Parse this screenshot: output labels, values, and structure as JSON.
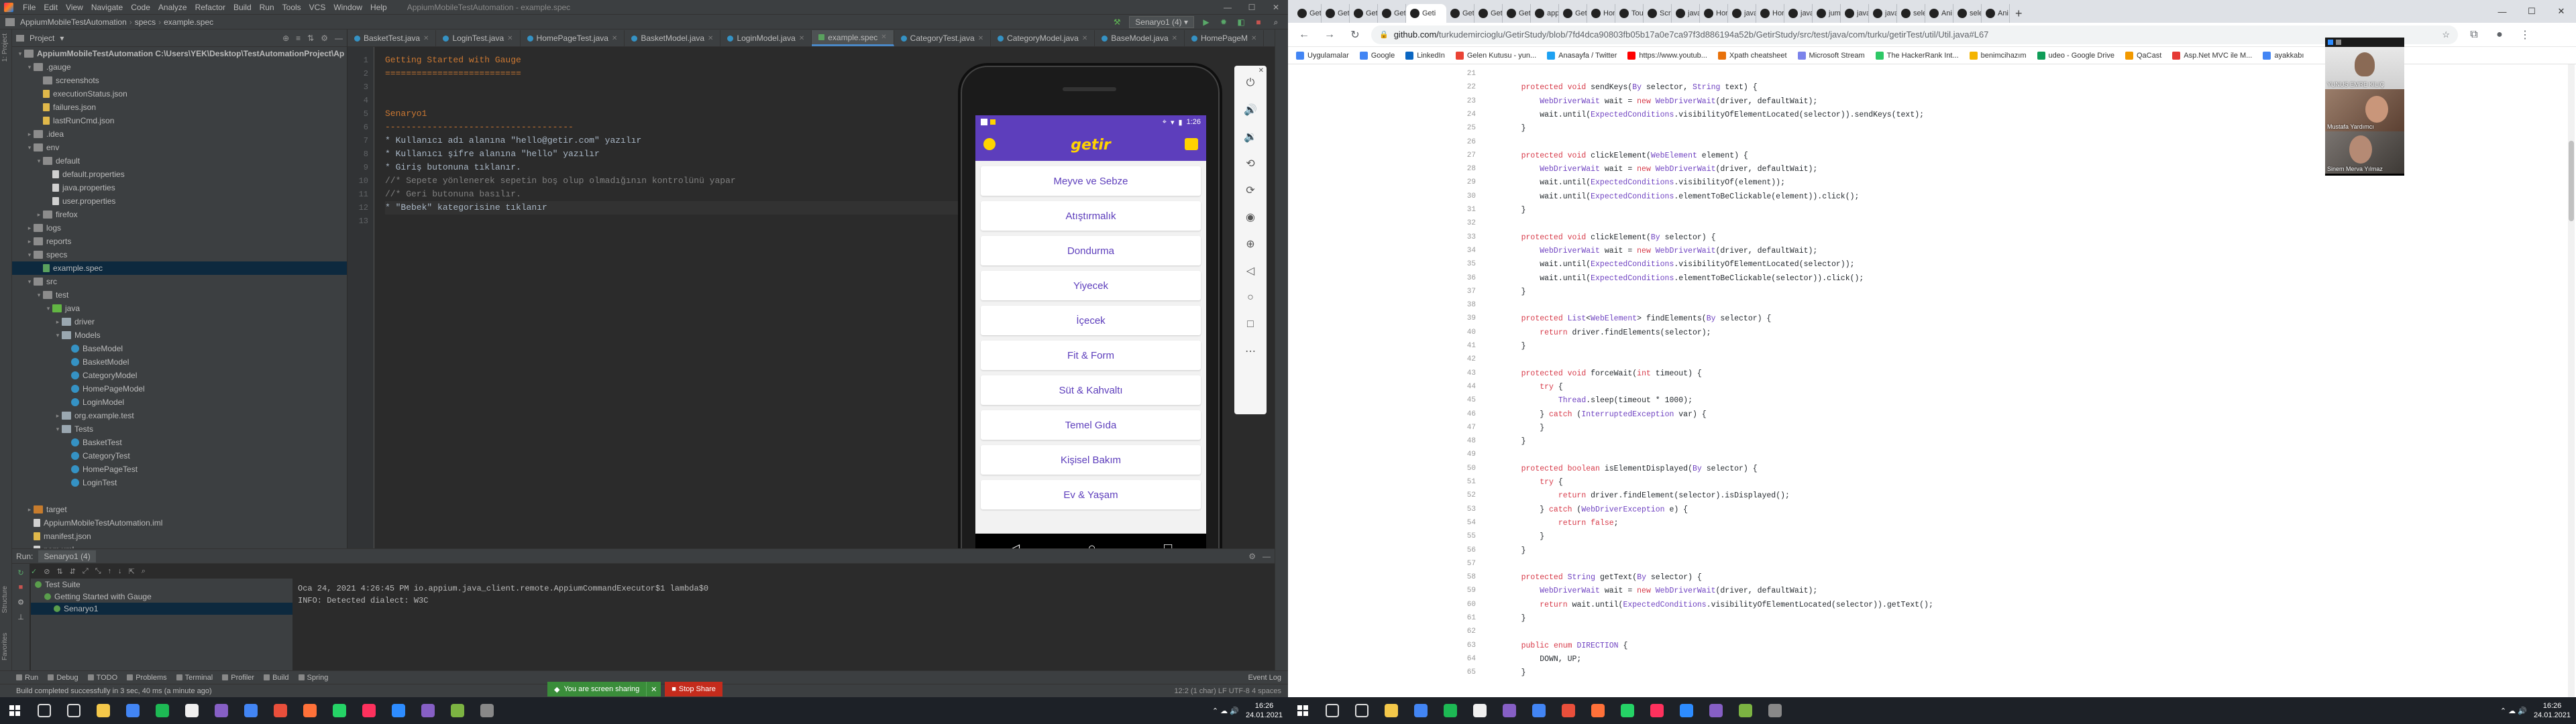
{
  "ide": {
    "title": "AppiumMobileTestAutomation - example.spec",
    "menu": [
      "File",
      "Edit",
      "View",
      "Navigate",
      "Code",
      "Analyze",
      "Refactor",
      "Build",
      "Run",
      "Tools",
      "VCS",
      "Window",
      "Help"
    ],
    "breadcrumb": [
      "AppiumMobileTestAutomation",
      "specs",
      "example.spec"
    ],
    "run_config": "Senaryo1 (4)",
    "project_label": "Project",
    "tree": [
      {
        "label": "AppiumMobileTestAutomation  C:\\Users\\YEK\\Desktop\\TestAutomationProject\\Ap",
        "depth": 0,
        "icon": "folder",
        "arrow": "▾",
        "bold": true
      },
      {
        "label": ".gauge",
        "depth": 1,
        "icon": "folder",
        "arrow": "▾"
      },
      {
        "label": "screenshots",
        "depth": 2,
        "icon": "folder",
        "arrow": ""
      },
      {
        "label": "executionStatus.json",
        "depth": 2,
        "icon": "json",
        "arrow": ""
      },
      {
        "label": "failures.json",
        "depth": 2,
        "icon": "json",
        "arrow": ""
      },
      {
        "label": "lastRunCmd.json",
        "depth": 2,
        "icon": "json",
        "arrow": ""
      },
      {
        "label": ".idea",
        "depth": 1,
        "icon": "folder",
        "arrow": "▸"
      },
      {
        "label": "env",
        "depth": 1,
        "icon": "folder",
        "arrow": "▾"
      },
      {
        "label": "default",
        "depth": 2,
        "icon": "folder",
        "arrow": "▾"
      },
      {
        "label": "default.properties",
        "depth": 3,
        "icon": "file",
        "arrow": ""
      },
      {
        "label": "java.properties",
        "depth": 3,
        "icon": "file",
        "arrow": ""
      },
      {
        "label": "user.properties",
        "depth": 3,
        "icon": "file",
        "arrow": ""
      },
      {
        "label": "firefox",
        "depth": 2,
        "icon": "folder",
        "arrow": "▸"
      },
      {
        "label": "logs",
        "depth": 1,
        "icon": "folder",
        "arrow": "▸"
      },
      {
        "label": "reports",
        "depth": 1,
        "icon": "folder",
        "arrow": "▸"
      },
      {
        "label": "specs",
        "depth": 1,
        "icon": "folder",
        "arrow": "▾"
      },
      {
        "label": "example.spec",
        "depth": 2,
        "icon": "spec",
        "arrow": "",
        "selected": true
      },
      {
        "label": "src",
        "depth": 1,
        "icon": "folder",
        "arrow": "▾"
      },
      {
        "label": "test",
        "depth": 2,
        "icon": "folder",
        "arrow": "▾"
      },
      {
        "label": "java",
        "depth": 3,
        "icon": "test",
        "arrow": "▾"
      },
      {
        "label": "driver",
        "depth": 4,
        "icon": "pkg",
        "arrow": "▸"
      },
      {
        "label": "Models",
        "depth": 4,
        "icon": "pkg",
        "arrow": "▾"
      },
      {
        "label": "BaseModel",
        "depth": 5,
        "icon": "class",
        "arrow": ""
      },
      {
        "label": "BasketModel",
        "depth": 5,
        "icon": "class",
        "arrow": ""
      },
      {
        "label": "CategoryModel",
        "depth": 5,
        "icon": "class",
        "arrow": ""
      },
      {
        "label": "HomePageModel",
        "depth": 5,
        "icon": "class",
        "arrow": ""
      },
      {
        "label": "LoginModel",
        "depth": 5,
        "icon": "class",
        "arrow": ""
      },
      {
        "label": "org.example.test",
        "depth": 4,
        "icon": "pkg",
        "arrow": "▸"
      },
      {
        "label": "Tests",
        "depth": 4,
        "icon": "pkg",
        "arrow": "▾"
      },
      {
        "label": "BasketTest",
        "depth": 5,
        "icon": "class",
        "arrow": ""
      },
      {
        "label": "CategoryTest",
        "depth": 5,
        "icon": "class",
        "arrow": ""
      },
      {
        "label": "HomePageTest",
        "depth": 5,
        "icon": "class",
        "arrow": ""
      },
      {
        "label": "LoginTest",
        "depth": 5,
        "icon": "class",
        "arrow": ""
      },
      {
        "label": "",
        "depth": 0,
        "icon": "",
        "arrow": ""
      },
      {
        "label": "target",
        "depth": 1,
        "icon": "excl",
        "arrow": "▸"
      },
      {
        "label": "AppiumMobileTestAutomation.iml",
        "depth": 1,
        "icon": "file",
        "arrow": ""
      },
      {
        "label": "manifest.json",
        "depth": 1,
        "icon": "json",
        "arrow": ""
      },
      {
        "label": "pom.xml",
        "depth": 1,
        "icon": "file",
        "arrow": ""
      }
    ],
    "tabs": [
      {
        "label": "BasketTest.java",
        "type": "class"
      },
      {
        "label": "LoginTest.java",
        "type": "class"
      },
      {
        "label": "HomePageTest.java",
        "type": "class"
      },
      {
        "label": "BasketModel.java",
        "type": "class"
      },
      {
        "label": "LoginModel.java",
        "type": "class"
      },
      {
        "label": "example.spec",
        "type": "spec",
        "active": true
      },
      {
        "label": "CategoryTest.java",
        "type": "class"
      },
      {
        "label": "CategoryModel.java",
        "type": "class"
      },
      {
        "label": "BaseModel.java",
        "type": "class"
      },
      {
        "label": "HomePageM",
        "type": "class"
      }
    ],
    "line_numbers": [
      "1",
      "2",
      "3",
      "4",
      "5",
      "6",
      "7",
      "8",
      "9",
      "10",
      "11",
      "12",
      "13"
    ],
    "code_lines": [
      {
        "text": "Getting Started with Gauge",
        "cls": "c-heading"
      },
      {
        "text": "==========================",
        "cls": "c-heading"
      },
      {
        "text": "",
        "cls": ""
      },
      {
        "text": "",
        "cls": ""
      },
      {
        "text": "Senaryo1",
        "cls": "c-sub"
      },
      {
        "text": "------------------------------------",
        "cls": "c-sub"
      },
      {
        "text": "* Kullanıcı adı alanına \"hello@getir.com\" yazılır",
        "cls": "c-step"
      },
      {
        "text": "* Kullanıcı şifre alanına \"hello\" yazılır",
        "cls": "c-step"
      },
      {
        "text": "* Giriş butonuna tıklanır.",
        "cls": "c-step"
      },
      {
        "text": "//* Sepete yönlenerek sepetin boş olup olmadığının kontrolünü yapar",
        "cls": "c-comment"
      },
      {
        "text": "//* Geri butonuna basılır.",
        "cls": "c-comment"
      },
      {
        "text": "* \"Bebek\" kategorisine tıklanır",
        "cls": "c-step"
      },
      {
        "text": "",
        "cls": ""
      }
    ],
    "run": {
      "label": "Run:",
      "config": "Senaryo1 (4)",
      "tree": [
        {
          "label": "Test Suite",
          "depth": 0
        },
        {
          "label": "Getting Started with Gauge",
          "depth": 1
        },
        {
          "label": "Senaryo1",
          "depth": 2,
          "selected": true
        }
      ],
      "console": [
        "Oca 24, 2021 4:26:45 PM io.appium.java_client.remote.AppiumCommandExecutor$1 lambda$0",
        "INFO: Detected dialect: W3C"
      ]
    },
    "bottom_tools": [
      "Run",
      "Debug",
      "TODO",
      "Problems",
      "Terminal",
      "Profiler",
      "Build",
      "Spring"
    ],
    "event_log": "Event Log",
    "status": "Build completed successfully in 3 sec, 40 ms (a minute ago)",
    "status_right": "12:2 (1 char)   LF   UTF-8   4 spaces",
    "share_msg": "You are screen sharing",
    "stop_share": "Stop Share"
  },
  "phone": {
    "time": "1:26",
    "brand": "getir",
    "categories": [
      "Meyve ve Sebze",
      "Atıştırmalık",
      "Dondurma",
      "Yiyecek",
      "İçecek",
      "Fit & Form",
      "Süt & Kahvaltı",
      "Temel Gıda",
      "Kişisel Bakım",
      "Ev & Yaşam"
    ]
  },
  "browser": {
    "tabs": [
      "Geti",
      "Geti",
      "Geti",
      "Geti",
      "Geti",
      "Geti",
      "Geti",
      "Geti",
      "app",
      "Geti",
      "Hom",
      "Tou",
      "Scre",
      "java",
      "Hor",
      "java",
      "Hor",
      "java",
      "jum",
      "java",
      "java",
      "sele",
      "Ani",
      "sele",
      "Ani"
    ],
    "active_tab": 4,
    "url_host": "github.com/",
    "url_path": "turkudemircioglu/GetirStudy/blob/7fd4dca90803fb05b17a0e7ca97f3d886194a52b/GetirStudy/src/test/java/com/turku/getirTest/util/Util.java#L67",
    "bookmarks": [
      "Uygulamalar",
      "Google",
      "LinkedIn",
      "Gelen Kutusu - yun...",
      "Anasayfa / Twitter",
      "https://www.youtub...",
      "Xpath cheatsheet",
      "Microsoft Stream",
      "The HackerRank Int...",
      "benimcihazım",
      "udeo - Google Drive",
      "QaCast",
      "Asp.Net MVC ile M...",
      "ayakkabı"
    ],
    "code": [
      {
        "n": "21",
        "t": ""
      },
      {
        "n": "22",
        "t": "    protected void sendKeys(By selector, String text) {"
      },
      {
        "n": "23",
        "t": "        WebDriverWait wait = new WebDriverWait(driver, defaultWait);"
      },
      {
        "n": "24",
        "t": "        wait.until(ExpectedConditions.visibilityOfElementLocated(selector)).sendKeys(text);"
      },
      {
        "n": "25",
        "t": "    }"
      },
      {
        "n": "26",
        "t": ""
      },
      {
        "n": "27",
        "t": "    protected void clickElement(WebElement element) {"
      },
      {
        "n": "28",
        "t": "        WebDriverWait wait = new WebDriverWait(driver, defaultWait);"
      },
      {
        "n": "29",
        "t": "        wait.until(ExpectedConditions.visibilityOf(element));"
      },
      {
        "n": "30",
        "t": "        wait.until(ExpectedConditions.elementToBeClickable(element)).click();"
      },
      {
        "n": "31",
        "t": "    }"
      },
      {
        "n": "32",
        "t": ""
      },
      {
        "n": "33",
        "t": "    protected void clickElement(By selector) {"
      },
      {
        "n": "34",
        "t": "        WebDriverWait wait = new WebDriverWait(driver, defaultWait);"
      },
      {
        "n": "35",
        "t": "        wait.until(ExpectedConditions.visibilityOfElementLocated(selector));"
      },
      {
        "n": "36",
        "t": "        wait.until(ExpectedConditions.elementToBeClickable(selector)).click();"
      },
      {
        "n": "37",
        "t": "    }"
      },
      {
        "n": "38",
        "t": ""
      },
      {
        "n": "39",
        "t": "    protected List<WebElement> findElements(By selector) {"
      },
      {
        "n": "40",
        "t": "        return driver.findElements(selector);"
      },
      {
        "n": "41",
        "t": "    }"
      },
      {
        "n": "42",
        "t": ""
      },
      {
        "n": "43",
        "t": "    protected void forceWait(int timeout) {"
      },
      {
        "n": "44",
        "t": "        try {"
      },
      {
        "n": "45",
        "t": "            Thread.sleep(timeout * 1000);"
      },
      {
        "n": "46",
        "t": "        } catch (InterruptedException var) {"
      },
      {
        "n": "47",
        "t": "        }"
      },
      {
        "n": "48",
        "t": "    }"
      },
      {
        "n": "49",
        "t": ""
      },
      {
        "n": "50",
        "t": "    protected boolean isElementDisplayed(By selector) {"
      },
      {
        "n": "51",
        "t": "        try {"
      },
      {
        "n": "52",
        "t": "            return driver.findElement(selector).isDisplayed();"
      },
      {
        "n": "53",
        "t": "        } catch (WebDriverException e) {"
      },
      {
        "n": "54",
        "t": "            return false;"
      },
      {
        "n": "55",
        "t": "        }"
      },
      {
        "n": "56",
        "t": "    }"
      },
      {
        "n": "57",
        "t": ""
      },
      {
        "n": "58",
        "t": "    protected String getText(By selector) {"
      },
      {
        "n": "59",
        "t": "        WebDriverWait wait = new WebDriverWait(driver, defaultWait);"
      },
      {
        "n": "60",
        "t": "        return wait.until(ExpectedConditions.visibilityOfElementLocated(selector)).getText();"
      },
      {
        "n": "61",
        "t": "    }"
      },
      {
        "n": "62",
        "t": ""
      },
      {
        "n": "63",
        "t": "    public enum DIRECTION {"
      },
      {
        "n": "64",
        "t": "        DOWN, UP;"
      },
      {
        "n": "65",
        "t": "    }"
      }
    ],
    "participants": [
      "YUNUS EMRE KILIÇ",
      "Mustafa Yardımcı",
      "Sinem Merva Yılmaz"
    ]
  },
  "taskbar": {
    "time": "16:26",
    "date": "24.01.2021",
    "icons": [
      "search-icon",
      "task-view-icon",
      "explorer-icon",
      "chrome-icon",
      "spotify-icon",
      "github-icon",
      "vs-icon",
      "chrome2-icon",
      "jetbrains-icon",
      "firefox-icon",
      "whatsapp-icon",
      "intellij-icon",
      "zoom-icon",
      "vs2-icon",
      "notepad-icon",
      "settings-icon"
    ]
  },
  "colors": {
    "getir_purple": "#5d3ebc",
    "getir_yellow": "#ffd300",
    "ide_bg": "#2b2b2b",
    "share_green": "#3a8d3a",
    "stop_red": "#c42b1c"
  }
}
